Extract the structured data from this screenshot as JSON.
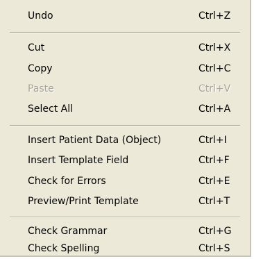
{
  "menu": {
    "groups": [
      [
        {
          "label": "Undo",
          "shortcut": "Ctrl+Z",
          "enabled": true
        }
      ],
      [
        {
          "label": "Cut",
          "shortcut": "Ctrl+X",
          "enabled": true
        },
        {
          "label": "Copy",
          "shortcut": "Ctrl+C",
          "enabled": true
        },
        {
          "label": "Paste",
          "shortcut": "Ctrl+V",
          "enabled": false
        },
        {
          "label": "Select All",
          "shortcut": "Ctrl+A",
          "enabled": true
        }
      ],
      [
        {
          "label": "Insert Patient Data (Object)",
          "shortcut": "Ctrl+I",
          "enabled": true
        },
        {
          "label": "Insert Template Field",
          "shortcut": "Ctrl+F",
          "enabled": true
        },
        {
          "label": "Check for Errors",
          "shortcut": "Ctrl+E",
          "enabled": true
        },
        {
          "label": "Preview/Print Template",
          "shortcut": "Ctrl+T",
          "enabled": true
        }
      ],
      [
        {
          "label": "Check Grammar",
          "shortcut": "Ctrl+G",
          "enabled": true
        },
        {
          "label": "Check Spelling",
          "shortcut": "Ctrl+S",
          "enabled": true
        }
      ]
    ]
  }
}
